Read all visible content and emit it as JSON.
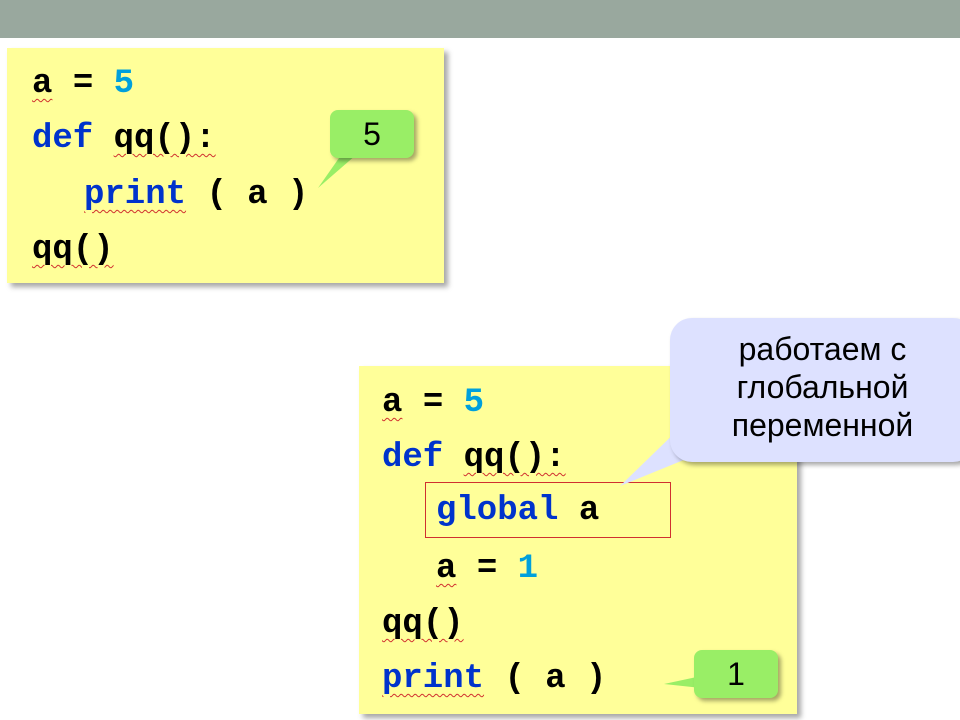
{
  "example1": {
    "line1": {
      "var": "a",
      "op": "=",
      "num": "5"
    },
    "line2": {
      "kw": "def",
      "name": "qq():"
    },
    "line3": {
      "kw": "print",
      "args": "( a )"
    },
    "line4": {
      "call": "qq()"
    },
    "output_callout": "5"
  },
  "example2": {
    "line1": {
      "var": "a",
      "op": "=",
      "num": "5"
    },
    "line2": {
      "kw": "def",
      "name": "qq():"
    },
    "line3": {
      "kw": "global",
      "var": "a"
    },
    "line4": {
      "var": "a",
      "op": "=",
      "num": "1"
    },
    "line5": {
      "call": "qq()"
    },
    "line6": {
      "kw": "print",
      "args": "( a )"
    },
    "note_callout": [
      "работаем с",
      "глобальной",
      "переменной"
    ],
    "output_callout": "1"
  },
  "colors": {
    "top_bar": "#99a89e",
    "code_background": "#ffff99",
    "keyword": "#0033cc",
    "number": "#00a0dc",
    "callout_green": "#99ee66",
    "callout_blue": "#dde1ff",
    "highlight_border": "#d03030"
  }
}
